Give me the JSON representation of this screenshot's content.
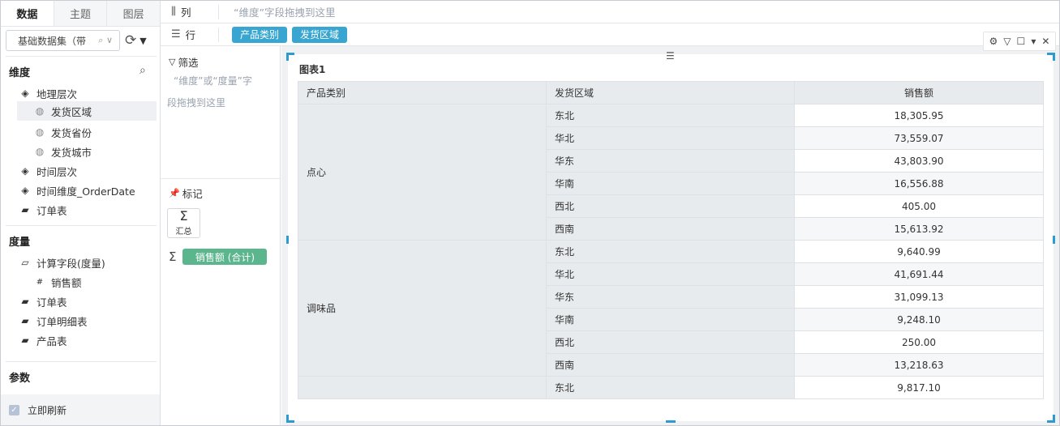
{
  "tabs": [
    "数据",
    "主题",
    "图层"
  ],
  "dataset": {
    "name": "基础数据集（带",
    "icons": "⌕ ∨"
  },
  "dimensions": {
    "title": "维度",
    "items": [
      {
        "label": "地理层次",
        "icon": "layers-icon"
      },
      {
        "label": "发货区域",
        "icon": "globe-icon"
      },
      {
        "label": "发货省份",
        "icon": "globe-icon"
      },
      {
        "label": "发货城市",
        "icon": "globe-icon"
      },
      {
        "label": "时间层次",
        "icon": "layers-icon"
      },
      {
        "label": "时间维度_OrderDate",
        "icon": "layers-icon"
      },
      {
        "label": "订单表",
        "icon": "folder-icon"
      }
    ]
  },
  "measures": {
    "title": "度量",
    "items": [
      {
        "label": "计算字段(度量)",
        "icon": "folder-open-icon"
      },
      {
        "label": "销售额",
        "icon": "number-field-icon"
      },
      {
        "label": "订单表",
        "icon": "folder-icon"
      },
      {
        "label": "订单明细表",
        "icon": "folder-icon"
      },
      {
        "label": "产品表",
        "icon": "folder-icon"
      }
    ]
  },
  "params": {
    "title": "参数"
  },
  "refresh": {
    "label": "立即刷新",
    "checked": true
  },
  "shelves": {
    "columns": {
      "label": "列",
      "hint": "“维度”字段拖拽到这里"
    },
    "rows": {
      "label": "行",
      "pills": [
        "产品类别",
        "发货区域"
      ]
    }
  },
  "filter": {
    "title": "筛选",
    "hint_line1": "“维度”或“度量”字",
    "hint_line2": "段拖拽到这里"
  },
  "marks": {
    "title": "标记",
    "sum_label": "汇总",
    "measure_pill": "销售额 (合计)"
  },
  "chart": {
    "title": "图表1",
    "headers": [
      "产品类别",
      "发货区域",
      "销售额"
    ],
    "groups": [
      {
        "category": "点心",
        "rows": [
          [
            "东北",
            "18,305.95"
          ],
          [
            "华北",
            "73,559.07"
          ],
          [
            "华东",
            "43,803.90"
          ],
          [
            "华南",
            "16,556.88"
          ],
          [
            "西北",
            "405.00"
          ],
          [
            "西南",
            "15,613.92"
          ]
        ]
      },
      {
        "category": "调味品",
        "rows": [
          [
            "东北",
            "9,640.99"
          ],
          [
            "华北",
            "41,691.44"
          ],
          [
            "华东",
            "31,099.13"
          ],
          [
            "华南",
            "9,248.10"
          ],
          [
            "西北",
            "250.00"
          ],
          [
            "西南",
            "13,218.63"
          ]
        ]
      },
      {
        "category": "",
        "rows": [
          [
            "东北",
            "9,817.10"
          ]
        ]
      }
    ]
  }
}
